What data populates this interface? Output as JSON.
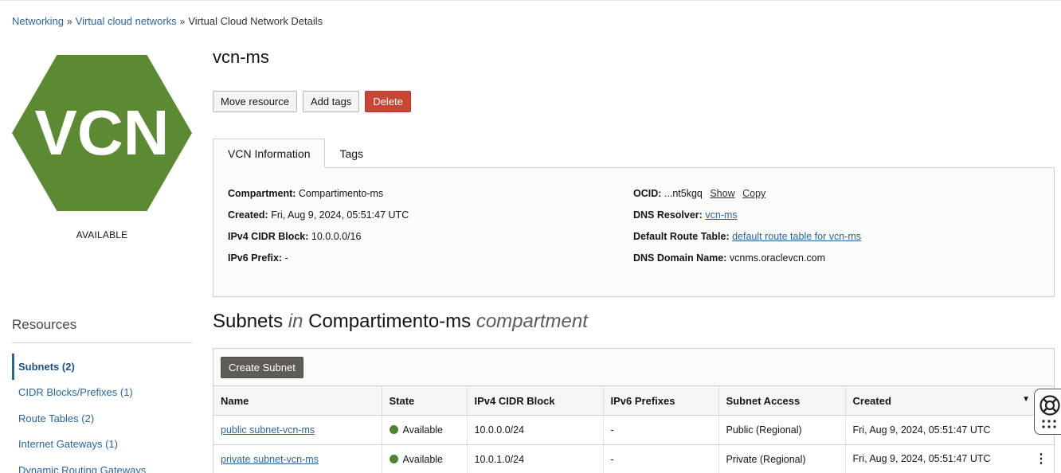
{
  "breadcrumb": {
    "items": [
      "Networking",
      "Virtual cloud networks",
      "Virtual Cloud Network Details"
    ],
    "separator": "»"
  },
  "resource_badge": {
    "text": "VCN",
    "color": "#5b8a33",
    "status": "AVAILABLE"
  },
  "page": {
    "title": "vcn-ms"
  },
  "actions": {
    "move_label": "Move resource",
    "tags_label": "Add tags",
    "delete_label": "Delete"
  },
  "tabs": [
    {
      "label": "VCN Information",
      "active": true
    },
    {
      "label": "Tags",
      "active": false
    }
  ],
  "vcn_info": {
    "compartment": {
      "label": "Compartment:",
      "value": "Compartimento-ms"
    },
    "created": {
      "label": "Created:",
      "value": "Fri, Aug 9, 2024, 05:51:47 UTC"
    },
    "ipv4_cidr": {
      "label": "IPv4 CIDR Block:",
      "value": "10.0.0.0/16"
    },
    "ipv6_prefix": {
      "label": "IPv6 Prefix:",
      "value": "-"
    },
    "ocid": {
      "label": "OCID:",
      "value": "...nt5kgq",
      "show_label": "Show",
      "copy_label": "Copy"
    },
    "dns_resolver": {
      "label": "DNS Resolver:",
      "value": "vcn-ms"
    },
    "default_route_table": {
      "label": "Default Route Table:",
      "value": "default route table for vcn-ms"
    },
    "dns_domain": {
      "label": "DNS Domain Name:",
      "value": "vcnms.oraclevcn.com"
    }
  },
  "resources": {
    "title": "Resources",
    "items": [
      {
        "label": "Subnets (2)",
        "active": true
      },
      {
        "label": "CIDR Blocks/Prefixes (1)",
        "active": false
      },
      {
        "label": "Route Tables (2)",
        "active": false
      },
      {
        "label": "Internet Gateways (1)",
        "active": false
      },
      {
        "label": "Dynamic Routing Gateways",
        "active": false
      }
    ]
  },
  "subnets_section": {
    "title_main": "Subnets",
    "title_in": "in",
    "title_compartment": "Compartimento-ms",
    "title_suffix": "compartment",
    "create_label": "Create Subnet",
    "columns": [
      "Name",
      "State",
      "IPv4 CIDR Block",
      "IPv6 Prefixes",
      "Subnet Access",
      "Created"
    ],
    "rows": [
      {
        "name": "public subnet-vcn-ms",
        "state": "Available",
        "ipv4": "10.0.0.0/24",
        "ipv6": "-",
        "access": "Public (Regional)",
        "created": "Fri, Aug 9, 2024, 05:51:47 UTC"
      },
      {
        "name": "private subnet-vcn-ms",
        "state": "Available",
        "ipv4": "10.0.1.0/24",
        "ipv6": "-",
        "access": "Private (Regional)",
        "created": "Fri, Aug 9, 2024, 05:51:47 UTC"
      }
    ],
    "state_color": "#4f8234"
  },
  "icons": {
    "sort": "sort-down-icon",
    "row_menu": "kebab-menu-icon",
    "help": "lifebuoy-icon",
    "grip": "grid-dots-icon"
  }
}
